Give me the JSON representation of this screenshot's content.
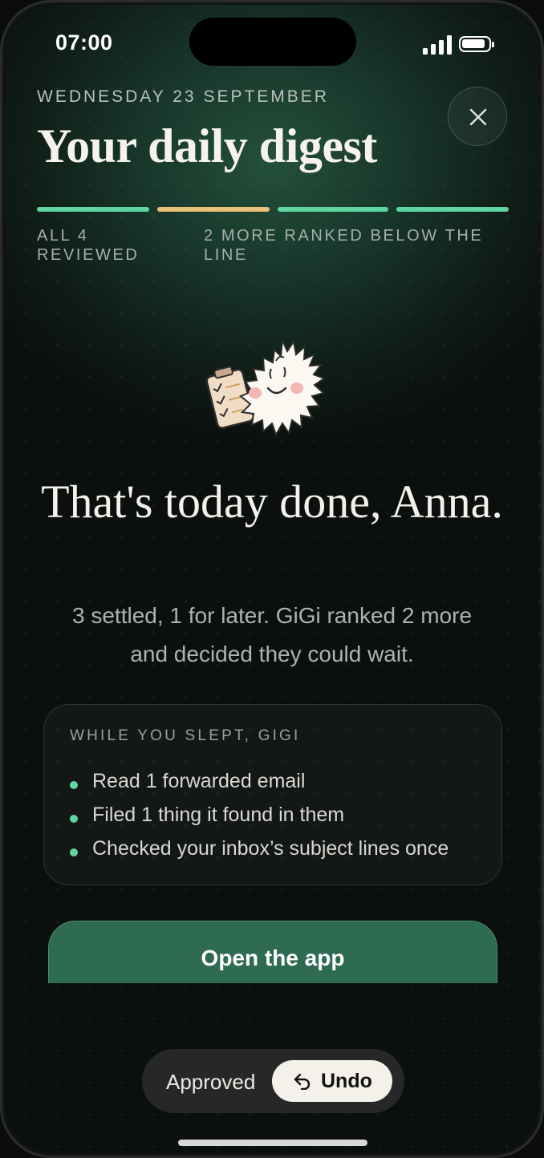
{
  "status_bar": {
    "time": "07:00"
  },
  "header": {
    "date": "WEDNESDAY 23 SEPTEMBER",
    "title": "Your daily digest"
  },
  "progress": {
    "segments": [
      {
        "status": "reviewed",
        "color": "#5fd6a0"
      },
      {
        "status": "later",
        "color": "#e8c27a"
      },
      {
        "status": "reviewed",
        "color": "#5fd6a0"
      },
      {
        "status": "reviewed",
        "color": "#5fd6a0"
      }
    ],
    "left_label": "ALL 4 REVIEWED",
    "right_label": "2 MORE RANKED BELOW THE LINE"
  },
  "summary": {
    "headline": "That's today done, Anna.",
    "subline": "3 settled, 1 for later. GiGi ranked 2 more and decided they could wait."
  },
  "overnight": {
    "heading": "WHILE YOU SLEPT, GIGI",
    "items": [
      "Read 1 forwarded email",
      "Filed 1 thing it found in them",
      "Checked your inbox’s subject lines once"
    ]
  },
  "cta": {
    "label": "Open the app"
  },
  "toast": {
    "label": "Approved",
    "undo_label": "Undo"
  },
  "icons": {
    "close": "close-icon",
    "undo": "undo-arrow-icon",
    "mascot": "gigi-mascot-with-clipboard"
  },
  "colors": {
    "accent_green": "#5fd6a0",
    "accent_amber": "#e8c27a",
    "cta_green": "#2f6b52"
  }
}
